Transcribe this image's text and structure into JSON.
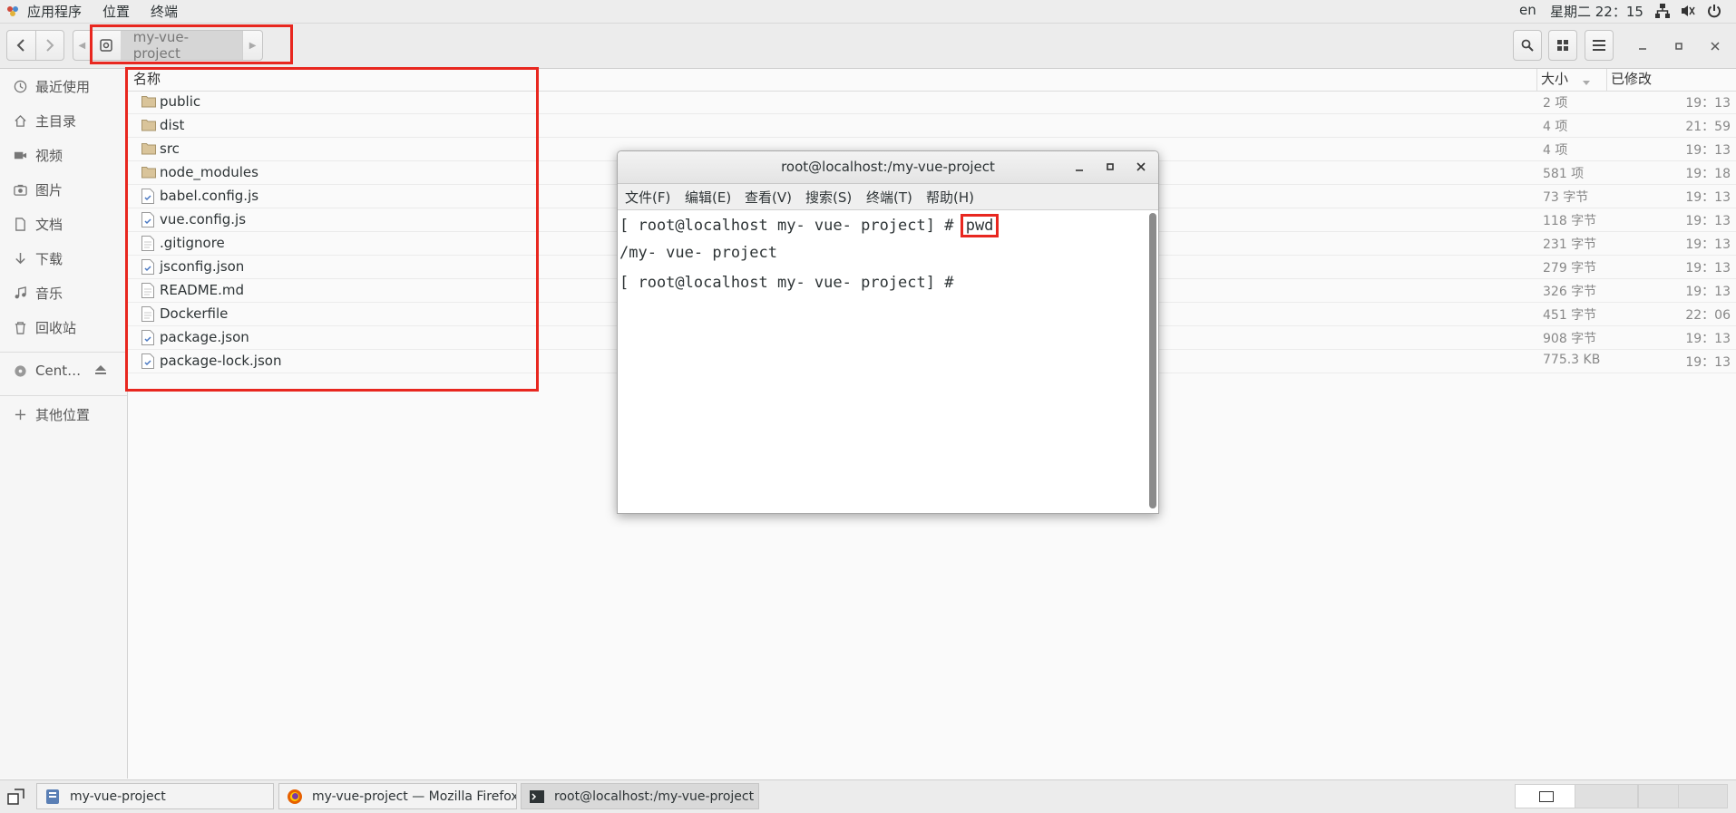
{
  "topbar": {
    "apps_label": "应用程序",
    "places_label": "位置",
    "terminal_label": "终端",
    "lang": "en",
    "clock": "星期二 22：15"
  },
  "header": {
    "path_segment": "my-vue-project"
  },
  "sidebar": {
    "items": [
      {
        "label": "最近使用",
        "icon": "clock-icon"
      },
      {
        "label": "主目录",
        "icon": "home-icon"
      },
      {
        "label": "视频",
        "icon": "video-icon"
      },
      {
        "label": "图片",
        "icon": "camera-icon"
      },
      {
        "label": "文档",
        "icon": "document-icon"
      },
      {
        "label": "下载",
        "icon": "download-icon"
      },
      {
        "label": "音乐",
        "icon": "music-icon"
      },
      {
        "label": "回收站",
        "icon": "trash-icon"
      },
      {
        "label": "Cent…",
        "icon": "disc-icon"
      },
      {
        "label": "其他位置",
        "icon": "plus-icon"
      }
    ]
  },
  "filelist": {
    "col_name": "名称",
    "col_size": "大小",
    "col_modified": "已修改",
    "rows": [
      {
        "name": "public",
        "type": "folder",
        "size": "2 项",
        "modified": "19：13"
      },
      {
        "name": "dist",
        "type": "folder",
        "size": "4 项",
        "modified": "21：59"
      },
      {
        "name": "src",
        "type": "folder",
        "size": "4 项",
        "modified": "19：13"
      },
      {
        "name": "node_modules",
        "type": "folder",
        "size": "581 项",
        "modified": "19：18"
      },
      {
        "name": "babel.config.js",
        "type": "script",
        "size": "73 字节",
        "modified": "19：13"
      },
      {
        "name": "vue.config.js",
        "type": "script",
        "size": "118 字节",
        "modified": "19：13"
      },
      {
        "name": ".gitignore",
        "type": "text",
        "size": "231 字节",
        "modified": "19：13"
      },
      {
        "name": "jsconfig.json",
        "type": "script",
        "size": "279 字节",
        "modified": "19：13"
      },
      {
        "name": "README.md",
        "type": "text",
        "size": "326 字节",
        "modified": "19：13"
      },
      {
        "name": "Dockerfile",
        "type": "text",
        "size": "451 字节",
        "modified": "22：06"
      },
      {
        "name": "package.json",
        "type": "script",
        "size": "908 字节",
        "modified": "19：13"
      },
      {
        "name": "package-lock.json",
        "type": "script",
        "size": "775.3 KB",
        "modified": "19：13"
      }
    ]
  },
  "terminal": {
    "title": "root@localhost:/my-vue-project",
    "menu": [
      "文件(F)",
      "编辑(E)",
      "查看(V)",
      "搜索(S)",
      "终端(T)",
      "帮助(H)"
    ],
    "prompt": "[ root@localhost my- vue- project] # ",
    "command": "pwd",
    "output": "/my- vue- project",
    "prompt2": "[ root@localhost my- vue- project] # "
  },
  "taskbar": {
    "tasks": [
      {
        "label": "my-vue-project",
        "icon": "file-manager-icon"
      },
      {
        "label": "my-vue-project — Mozilla Firefox",
        "icon": "firefox-icon"
      },
      {
        "label": "root@localhost:/my-vue-project",
        "icon": "terminal-icon"
      }
    ]
  },
  "colors": {
    "annotation": "#e8271f",
    "folder": "#d9c49a"
  }
}
